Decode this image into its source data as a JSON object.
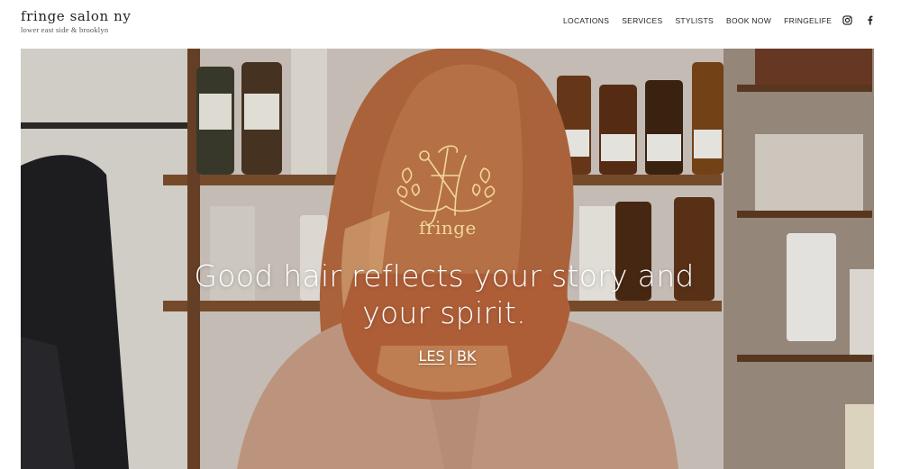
{
  "brand": {
    "name": "fringe salon ny",
    "tagline": "lower east side & brooklyn"
  },
  "nav": {
    "items": [
      "LOCATIONS",
      "SERVICES",
      "STYLISTS",
      "BOOK NOW",
      "FRINGELIFE"
    ]
  },
  "social": {
    "icons": [
      "instagram-icon",
      "facebook-icon"
    ]
  },
  "hero": {
    "logo_text": "fringe",
    "headline": "Good hair reflects your story and your spirit.",
    "locations": [
      "LES",
      "BK"
    ],
    "separator": "|"
  },
  "colors": {
    "logo_gold": "#f0d79a",
    "hair": "#b8643a",
    "shirt": "#c99a82"
  }
}
